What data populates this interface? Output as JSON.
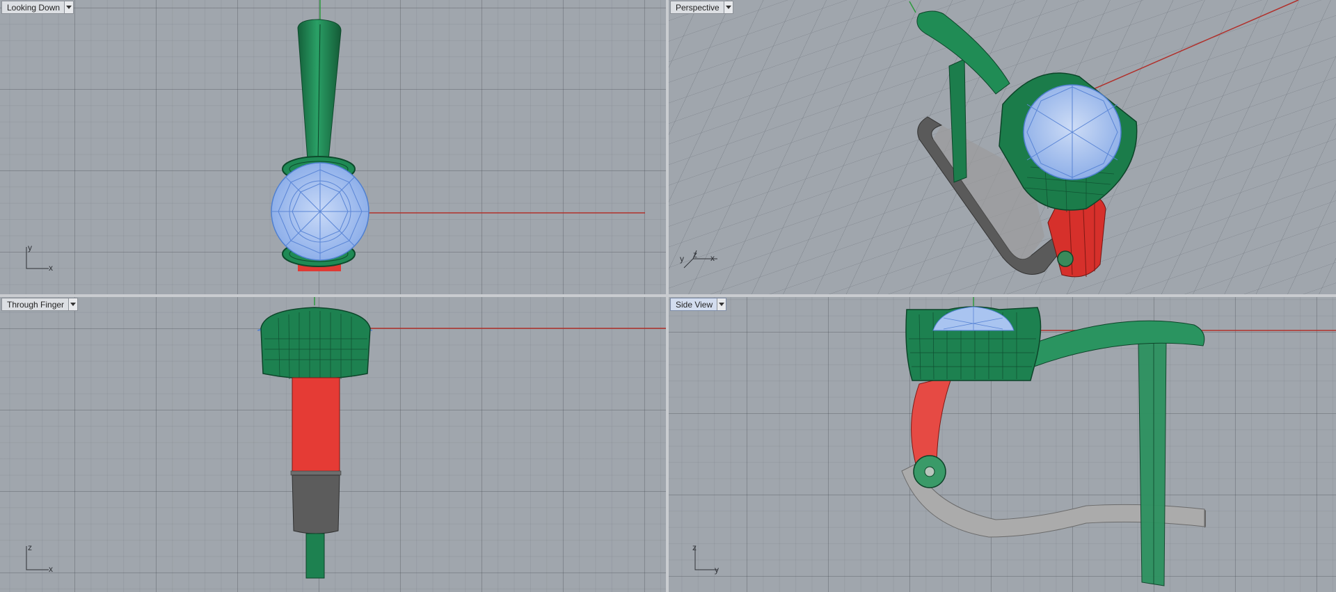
{
  "viewports": {
    "top_left": {
      "title": "Looking Down",
      "axis_x": "x",
      "axis_y": "y"
    },
    "top_right": {
      "title": "Perspective",
      "axis_x": "x",
      "axis_y": "y",
      "axis_z": "z"
    },
    "bottom_left": {
      "title": "Through Finger",
      "axis_x": "x",
      "axis_y": "z"
    },
    "bottom_right": {
      "title": "Side View",
      "axis_x": "y",
      "axis_y": "z",
      "active": true
    }
  },
  "colors": {
    "viewport_bg": "#a0a6ad",
    "grid": "#6e737a",
    "axis_x": "#b1302b",
    "axis_y": "#2e9a3e",
    "shank_green": "#1f8a55",
    "gem_blue": "#a9c4f0",
    "hinge_red": "#e03a34",
    "band_grey": "#9c9c9c",
    "band_dark": "#555555"
  }
}
